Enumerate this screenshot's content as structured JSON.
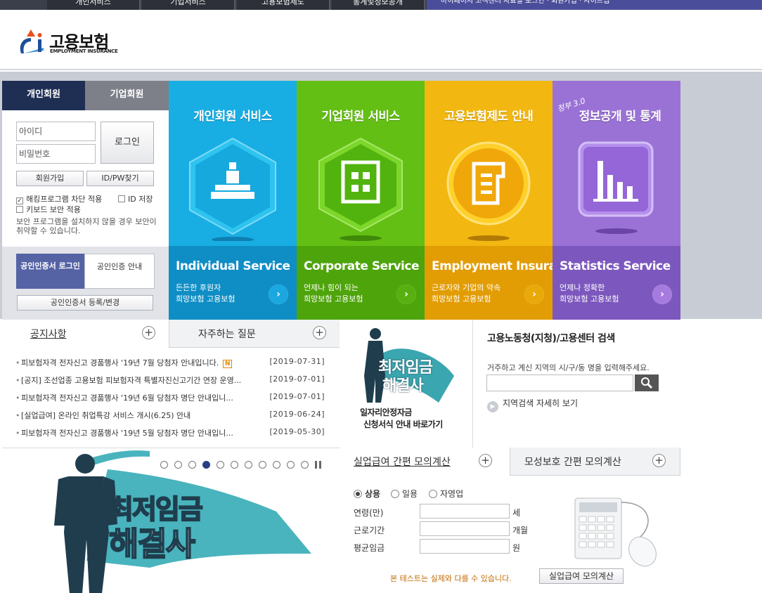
{
  "topnav": {
    "tabs": [
      "개인서비스",
      "기업서비스",
      "고용보험제도",
      "통계및정보공개"
    ],
    "util": "마이페이지  고객센터  자료실       로그인 · 회원가입 · 사이트맵"
  },
  "header": {
    "logo_text": "고용보험",
    "logo_sub": "EMPLOYMENT INSURANCE"
  },
  "login": {
    "tab_personal": "개인회원",
    "tab_company": "기업회원",
    "id_placeholder": "아이디",
    "pw_placeholder": "비밀번호",
    "login_button": "로그인",
    "join_button": "회원가입",
    "find_button": "ID/PW찾기",
    "chk_hacking": "해킹프로그램 차단 적용",
    "chk_saveid": "ID 저장",
    "chk_keyboard": "키보드 보안 적용",
    "notice": "보안 프로그램을 설치하지 않을 경우 보안이 취약할 수 있습니다.",
    "cert_login": "공인인증서 로그인",
    "cert_guide": "공인인증 안내",
    "cert_register": "공인인증서 등록/변경"
  },
  "tiles": [
    {
      "title": "개인회원 서비스",
      "en": "Individual Service",
      "desc1": "든든한 후원자",
      "desc2": "희망보험 고용보험",
      "top_color": "#18aee3",
      "bot_color": "#0f8ec6",
      "arrow_color": "#1ba7e0"
    },
    {
      "title": "기업회원 서비스",
      "en": "Corporate Service",
      "desc1": "언제나 힘이 되는",
      "desc2": "희망보험 고용보험",
      "top_color": "#64bf14",
      "bot_color": "#4ea40b",
      "arrow_color": "#58b010"
    },
    {
      "title": "고용보험제도 안내",
      "en": "Employment Insurance",
      "desc1": "근로자와 기업의 약속",
      "desc2": "희망보험 고용보험",
      "top_color": "#f2b811",
      "bot_color": "#e29d05",
      "arrow_color": "#eaa90a"
    },
    {
      "title": "정보공개 및 통계",
      "badge": "정부 3.0",
      "en": "Statistics Service",
      "desc1": "언제나 정확한",
      "desc2": "희망보험 고용보험",
      "top_color": "#9a72d6",
      "bot_color": "#7c58be",
      "arrow_color": "#a67be0"
    }
  ],
  "board": {
    "tab_notice": "공지사항",
    "tab_faq": "자주하는 질문",
    "new_badge": "N",
    "items": [
      {
        "title": "피보험자격 전자신고 경품행사 '19년 7월 당첨자 안내입니다.",
        "date": "[2019-07-31]",
        "new": true
      },
      {
        "title": "[공지] 조선업종 고용보험 피보험자격 특별자진신고기간 연장 운영...",
        "date": "[2019-07-01]"
      },
      {
        "title": "피보험자격 전자신고 경품행사 '19년 6월 당첨자 명단 안내입니...",
        "date": "[2019-07-01]"
      },
      {
        "title": "[실업급여] 온라인 취업특강 서비스 개시(6.25) 안내",
        "date": "[2019-06-24]"
      },
      {
        "title": "피보험자격 전자신고 경품행사 '19년 5월 당첨자 명단 안내입니...",
        "date": "[2019-05-30]"
      }
    ]
  },
  "promo": {
    "title_line1": "최저임금",
    "title_line2": "해결사",
    "sub1": "일자리안정자금",
    "sub2": "신청서식 안내 바로가기"
  },
  "center_search": {
    "heading": "고용노동청(지청)/고용센터 검색",
    "desc": "거주하고 계신 지역의 시/구/동 명을 입력해주세요.",
    "more": "지역검색 자세히 보기"
  },
  "banner": {
    "line1": "최저임금",
    "line2": "해결사",
    "slide_count": 11,
    "active_slide": 4
  },
  "calc": {
    "tab_unemployment": "실업급여 간편 모의계산",
    "tab_maternity": "모성보호 간편 모의계산",
    "radios": [
      "상용",
      "일용",
      "자영업"
    ],
    "selected": "상용",
    "fields": [
      {
        "label": "연령(만)",
        "unit": "세"
      },
      {
        "label": "근로기간",
        "unit": "개월"
      },
      {
        "label": "평균임금",
        "unit": "원"
      }
    ],
    "note": "본 테스트는 실제와 다를 수 있습니다.",
    "button": "실업급여 모의계산"
  }
}
